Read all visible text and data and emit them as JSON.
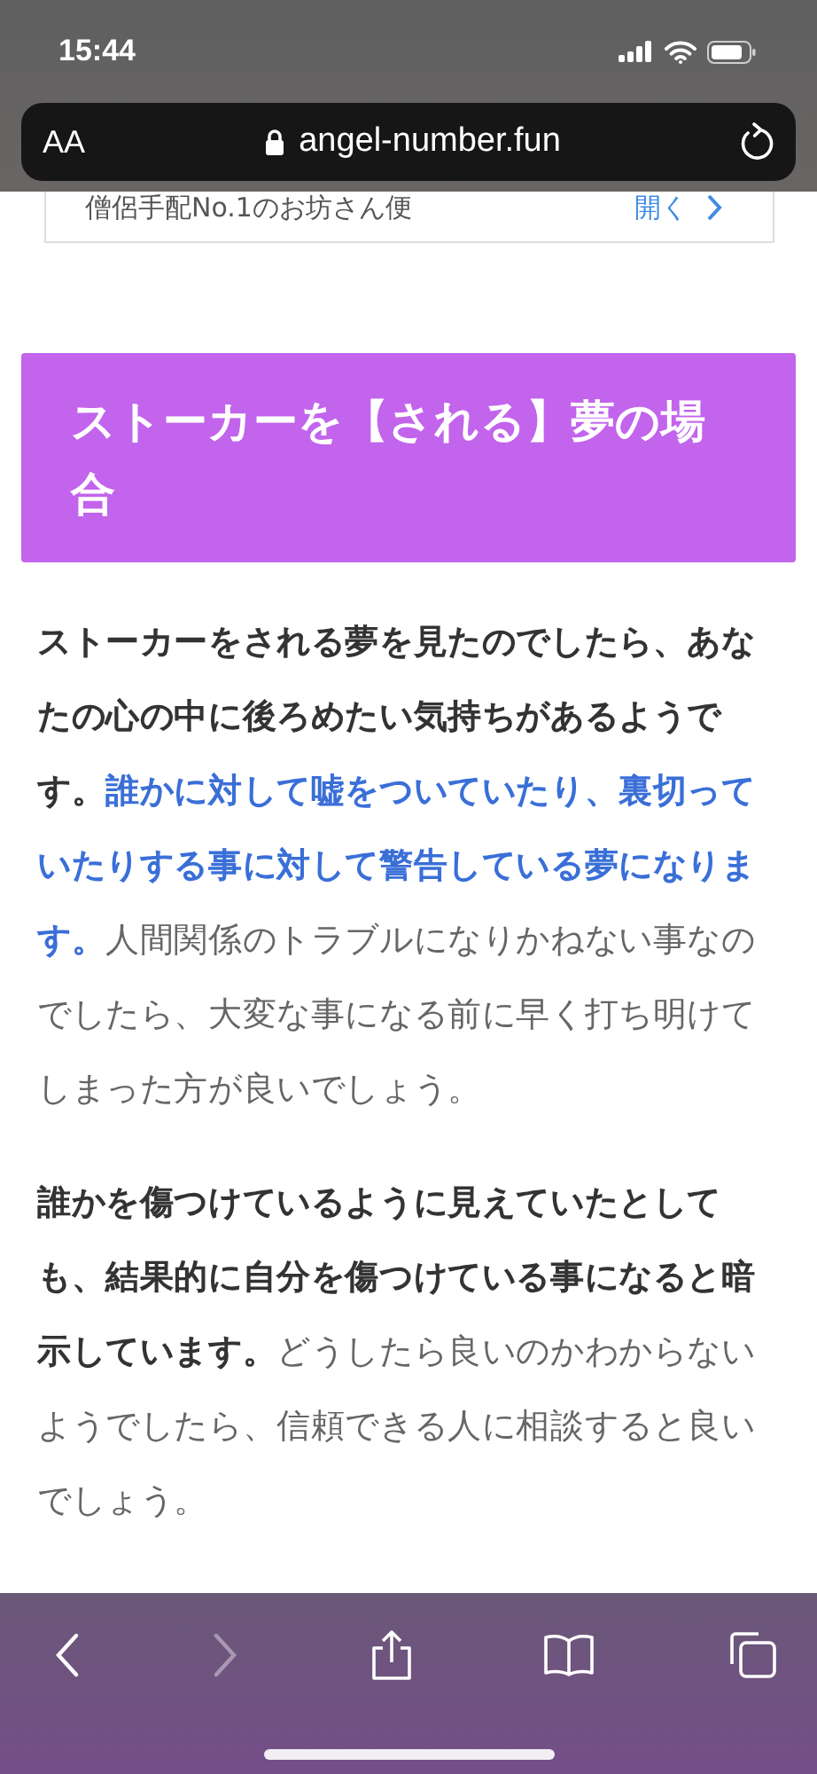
{
  "status_bar": {
    "time": "15:44"
  },
  "address_bar": {
    "text_size_button": "AA",
    "url": "angel-number.fun"
  },
  "ad_banner": {
    "text": "僧侶手配No.1のお坊さん便",
    "action": "開く"
  },
  "heading": "ストーカーを【される】夢の場合",
  "paragraphs": [
    [
      {
        "kind": "bold",
        "text": "ストーカーをされる夢を見たのでしたら、あなたの心の中に後ろめたい気持ちがあるようです。"
      },
      {
        "kind": "link",
        "text": "誰かに対して嘘をついていたり、裏切っていたりする事に対して警告している夢になります。"
      },
      {
        "kind": "plain",
        "text": "人間関係のトラブルになりかねない事なのでしたら、大変な事になる前に早く打ち明けてしまった方が良いでしょう。"
      }
    ],
    [
      {
        "kind": "bold",
        "text": "誰かを傷つけているように見えていたとしても、結果的に自分を傷つけている事になると暗示しています。"
      },
      {
        "kind": "plain",
        "text": "どうしたら良いのかわからないようでしたら、信頼できる人に相談すると良いでしょう。"
      }
    ]
  ],
  "toolbar": {
    "back": {
      "disabled": false
    },
    "forward": {
      "disabled": true
    }
  }
}
